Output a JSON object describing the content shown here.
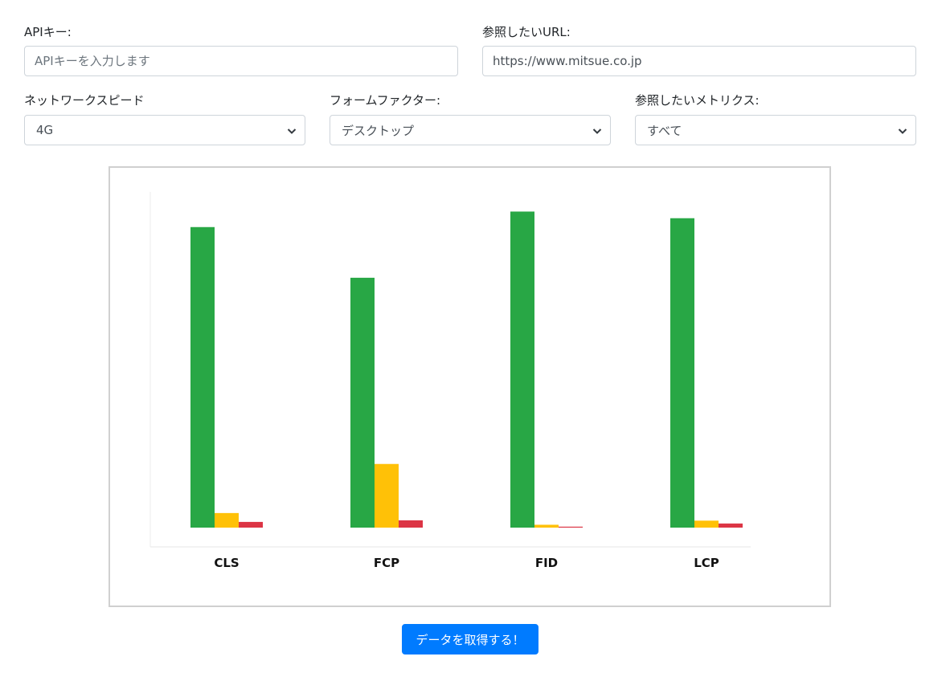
{
  "form": {
    "api_key": {
      "label": "APIキー:",
      "value": "",
      "placeholder": "APIキーを入力します"
    },
    "url": {
      "label": "参照したいURL:",
      "value": "https://www.mitsue.co.jp",
      "placeholder": ""
    },
    "network": {
      "label": "ネットワークスピード",
      "selected": "4G"
    },
    "form_factor": {
      "label": "フォームファクター:",
      "selected": "デスクトップ"
    },
    "metrics": {
      "label": "参照したいメトリクス:",
      "selected": "すべて"
    }
  },
  "submit_label": "データを取得する！",
  "colors": {
    "good": "#28a745",
    "needs_improvement": "#ffc107",
    "poor": "#dc3545"
  },
  "chart_data": {
    "type": "bar",
    "title": "",
    "xlabel": "",
    "ylabel": "",
    "categories": [
      "CLS",
      "FCP",
      "FID",
      "LCP"
    ],
    "series": [
      {
        "color": "#28a745",
        "values": [
          0.949,
          0.789,
          0.998,
          0.977
        ]
      },
      {
        "color": "#ffc107",
        "values": [
          0.046,
          0.201,
          0.009,
          0.022
        ]
      },
      {
        "color": "#dc3545",
        "values": [
          0.018,
          0.023,
          0.003,
          0.013
        ]
      }
    ],
    "ylim": [
      0,
      1.06
    ],
    "grid": false,
    "legend": "none"
  }
}
